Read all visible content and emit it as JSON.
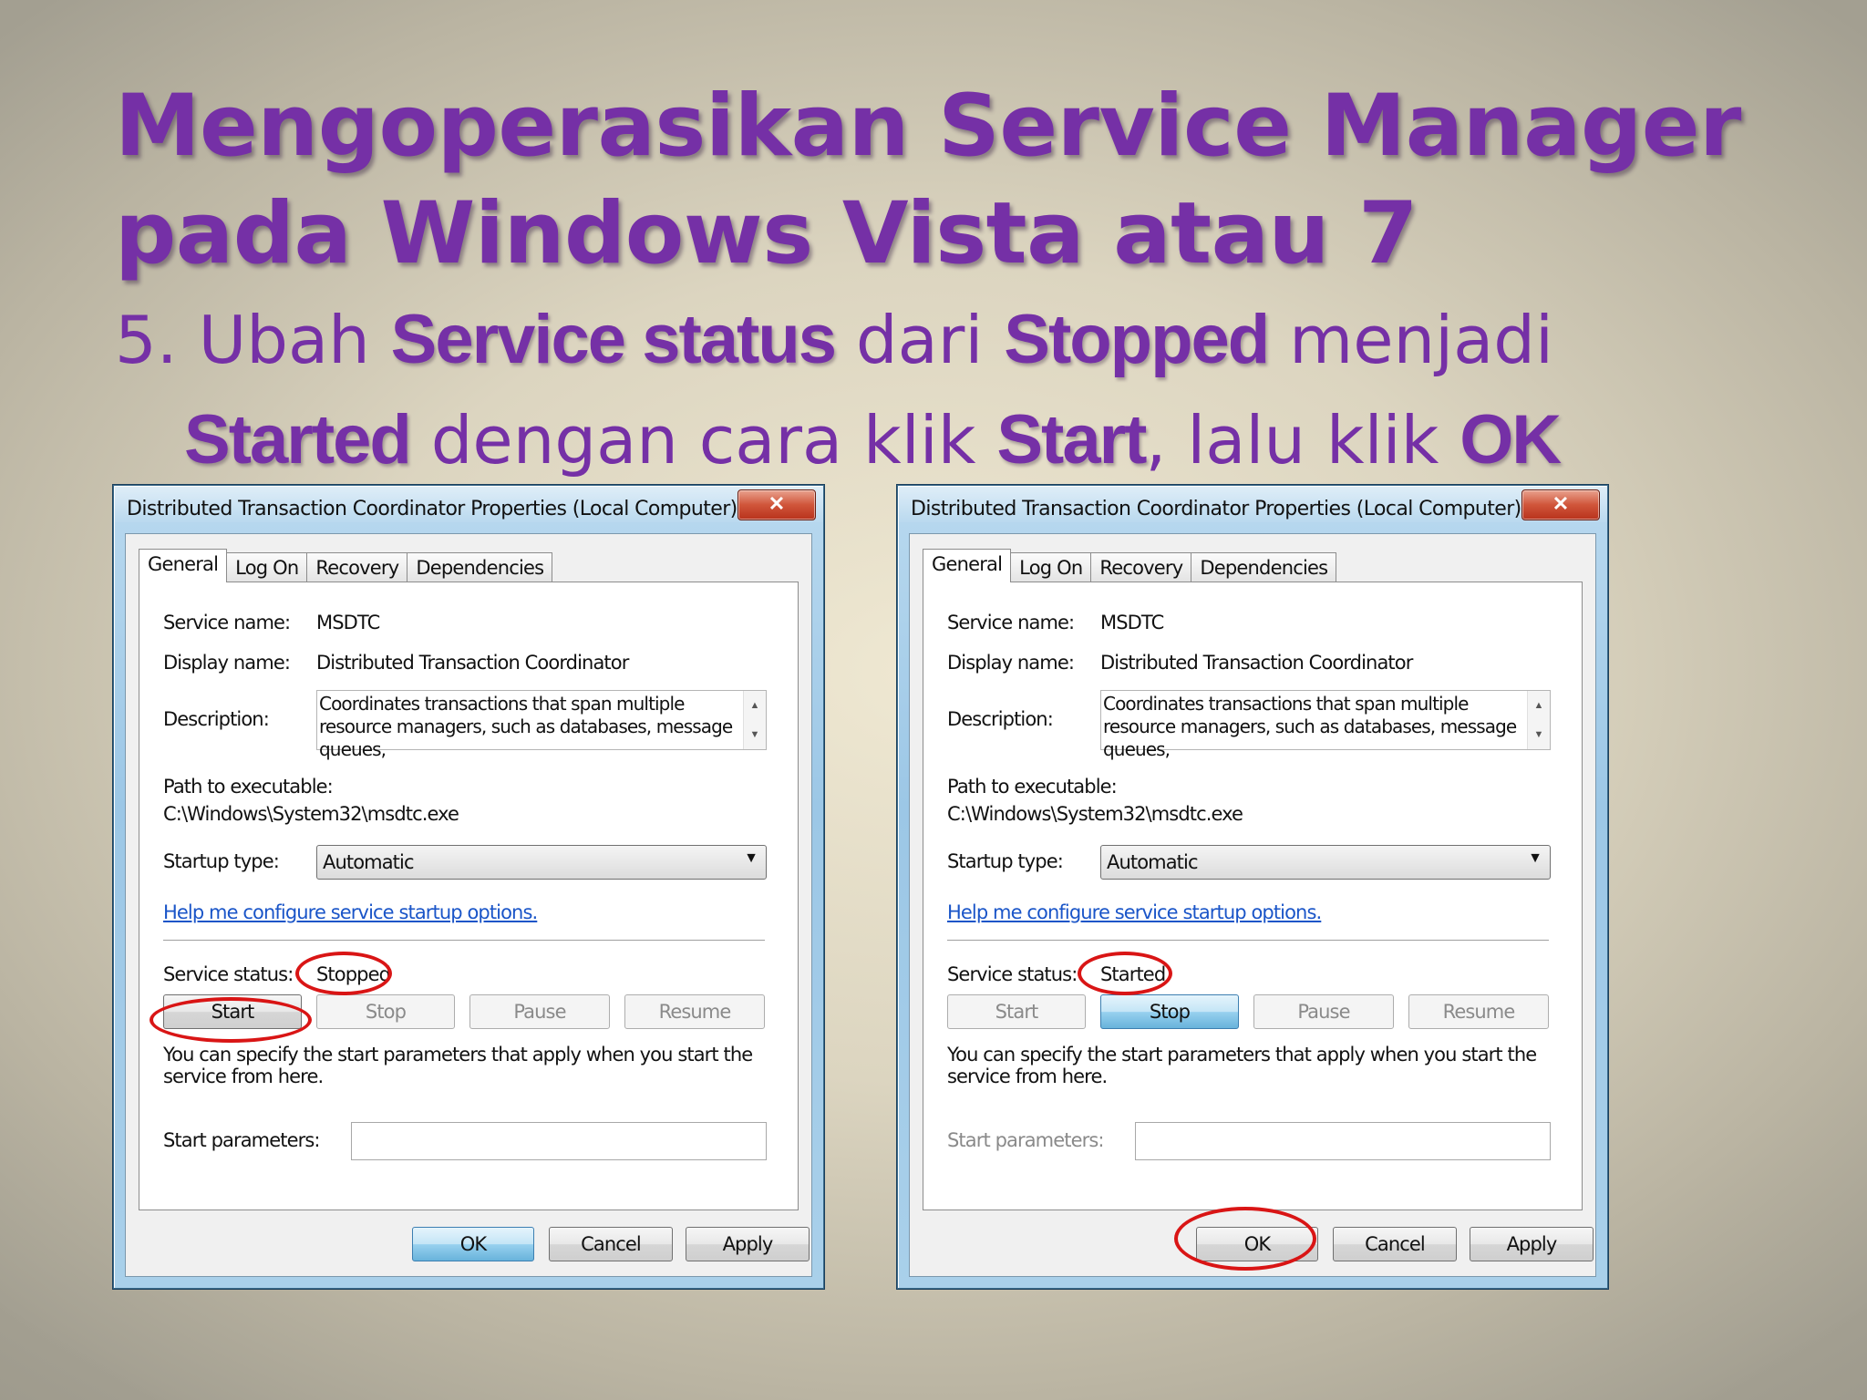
{
  "slide": {
    "title_line1": "Mengoperasikan Service Manager",
    "title_line2": "pada Windows Vista atau 7",
    "step": {
      "p1": "5. Ubah ",
      "b1": "Service status",
      "p2": " dari ",
      "b2": "Stopped",
      "p3": " menjadi",
      "b3": "Started",
      "p4": " dengan cara klik ",
      "b4": "Start",
      "p5": ", lalu klik ",
      "b5": "OK"
    }
  },
  "dialogs": [
    {
      "window_title": "Distributed Transaction Coordinator Properties (Local Computer)",
      "close": "✕",
      "tabs": [
        "General",
        "Log On",
        "Recovery",
        "Dependencies"
      ],
      "service_name_label": "Service name:",
      "service_name": "MSDTC",
      "display_name_label": "Display name:",
      "display_name": "Distributed Transaction Coordinator",
      "description_label": "Description:",
      "description": "Coordinates transactions that span multiple resource managers, such as databases, message queues,",
      "path_label": "Path to executable:",
      "path": "C:\\Windows\\System32\\msdtc.exe",
      "startup_label": "Startup type:",
      "startup_value": "Automatic",
      "help_link": "Help me configure service startup options.",
      "status_label": "Service status:",
      "status_value": "Stopped",
      "buttons": {
        "start": "Start",
        "stop": "Stop",
        "pause": "Pause",
        "resume": "Resume"
      },
      "info": "You can specify the start parameters that apply when you start the service from here.",
      "params_label": "Start parameters:",
      "bottom": {
        "ok": "OK",
        "cancel": "Cancel",
        "apply": "Apply"
      }
    },
    {
      "window_title": "Distributed Transaction Coordinator Properties (Local Computer)",
      "close": "✕",
      "tabs": [
        "General",
        "Log On",
        "Recovery",
        "Dependencies"
      ],
      "service_name_label": "Service name:",
      "service_name": "MSDTC",
      "display_name_label": "Display name:",
      "display_name": "Distributed Transaction Coordinator",
      "description_label": "Description:",
      "description": "Coordinates transactions that span multiple resource managers, such as databases, message queues,",
      "path_label": "Path to executable:",
      "path": "C:\\Windows\\System32\\msdtc.exe",
      "startup_label": "Startup type:",
      "startup_value": "Automatic",
      "help_link": "Help me configure service startup options.",
      "status_label": "Service status:",
      "status_value": "Started",
      "buttons": {
        "start": "Start",
        "stop": "Stop",
        "pause": "Pause",
        "resume": "Resume"
      },
      "info": "You can specify the start parameters that apply when you start the service from here.",
      "params_label": "Start parameters:",
      "bottom": {
        "ok": "OK",
        "cancel": "Cancel",
        "apply": "Apply"
      }
    }
  ],
  "colors": {
    "title": "#7530a6",
    "highlight_oval": "#d91515",
    "link": "#1a55c8"
  },
  "icons": {
    "close": "close-icon",
    "dropdown": "chevron-down-icon",
    "scroll_up": "arrow-up-icon",
    "scroll_down": "arrow-down-icon"
  }
}
